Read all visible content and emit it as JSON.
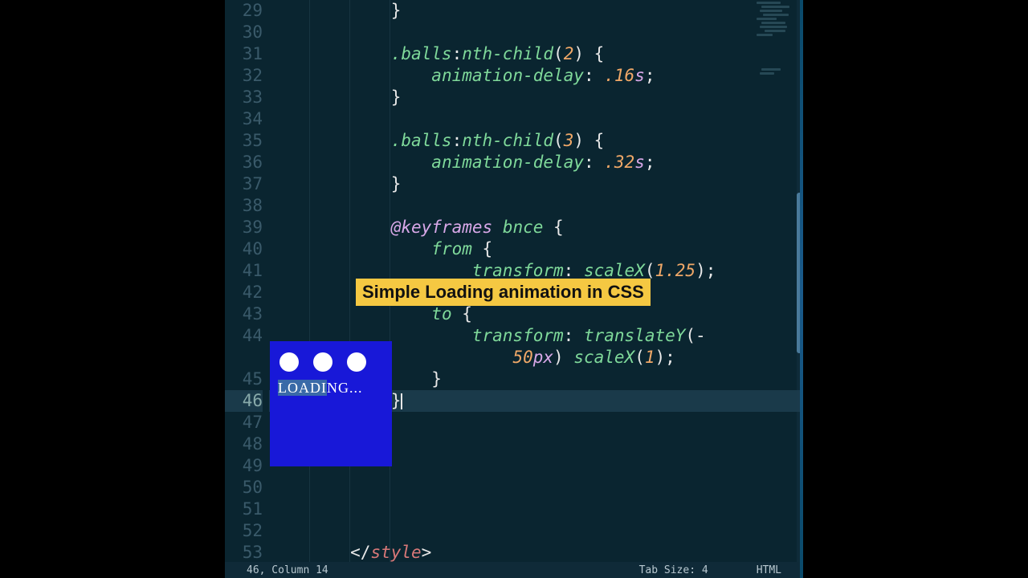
{
  "gutter": {
    "start": 29,
    "end": 53,
    "active": 46
  },
  "code_lines": [
    {
      "n": 29,
      "html": "            <span class='tok-punc'>}</span>"
    },
    {
      "n": 30,
      "html": ""
    },
    {
      "n": 31,
      "html": "            <span class='tok-sel'>.balls</span><span class='tok-punc'>:</span><span class='tok-func'>nth-child</span><span class='tok-punc'>(</span><span class='tok-num'>2</span><span class='tok-punc'>) {</span>"
    },
    {
      "n": 32,
      "html": "                <span class='tok-prop'>animation-delay</span><span class='tok-punc'>: </span><span class='tok-num'>.16</span><span class='tok-unit'>s</span><span class='tok-punc'>;</span>"
    },
    {
      "n": 33,
      "html": "            <span class='tok-punc'>}</span>"
    },
    {
      "n": 34,
      "html": ""
    },
    {
      "n": 35,
      "html": "            <span class='tok-sel'>.balls</span><span class='tok-punc'>:</span><span class='tok-func'>nth-child</span><span class='tok-punc'>(</span><span class='tok-num'>3</span><span class='tok-punc'>) {</span>"
    },
    {
      "n": 36,
      "html": "                <span class='tok-prop'>animation-delay</span><span class='tok-punc'>: </span><span class='tok-num'>.32</span><span class='tok-unit'>s</span><span class='tok-punc'>;</span>"
    },
    {
      "n": 37,
      "html": "            <span class='tok-punc'>}</span>"
    },
    {
      "n": 38,
      "html": ""
    },
    {
      "n": 39,
      "html": "            <span class='tok-at'>@keyframes</span> <span class='tok-sel'>bnce</span> <span class='tok-punc'>{</span>"
    },
    {
      "n": 40,
      "html": "                <span class='tok-kw'>from</span> <span class='tok-punc'>{</span>"
    },
    {
      "n": 41,
      "html": "                    <span class='tok-prop'>transform</span><span class='tok-punc'>: </span><span class='tok-func'>scaleX</span><span class='tok-punc'>(</span><span class='tok-num'>1.25</span><span class='tok-punc'>);</span>"
    },
    {
      "n": 42,
      "html": "                <span class='tok-punc'>}</span>"
    },
    {
      "n": 43,
      "html": "                <span class='tok-kw'>to</span> <span class='tok-punc'>{</span>"
    },
    {
      "n": 44,
      "html": "                    <span class='tok-prop'>transform</span><span class='tok-punc'>: </span><span class='tok-func'>translateY</span><span class='tok-punc'>(-</span>"
    },
    {
      "n": -1,
      "html": "                        <span class='tok-num'>50</span><span class='tok-unit'>px</span><span class='tok-punc'>) </span><span class='tok-func'>scaleX</span><span class='tok-punc'>(</span><span class='tok-num'>1</span><span class='tok-punc'>);</span>"
    },
    {
      "n": 45,
      "html": "                <span class='tok-punc'>}</span>"
    },
    {
      "n": 46,
      "html": "            <span class='tok-punc'>}</span><span class='cursor'></span>",
      "active": true
    },
    {
      "n": 47,
      "html": ""
    },
    {
      "n": 48,
      "html": ""
    },
    {
      "n": 49,
      "html": ""
    },
    {
      "n": 50,
      "html": ""
    },
    {
      "n": 51,
      "html": ""
    },
    {
      "n": 52,
      "html": ""
    },
    {
      "n": 53,
      "html": "        <span class='tok-punc'>&lt;/</span><span class='tok-tag'>style</span><span class='tok-punc'>&gt;</span>"
    }
  ],
  "status": {
    "position": "46, Column 14",
    "tabsize": "Tab Size: 4",
    "language": "HTML"
  },
  "banner": "Simple Loading animation in CSS",
  "preview": {
    "text_hl": "LOADI",
    "text_rest": "NG..."
  }
}
